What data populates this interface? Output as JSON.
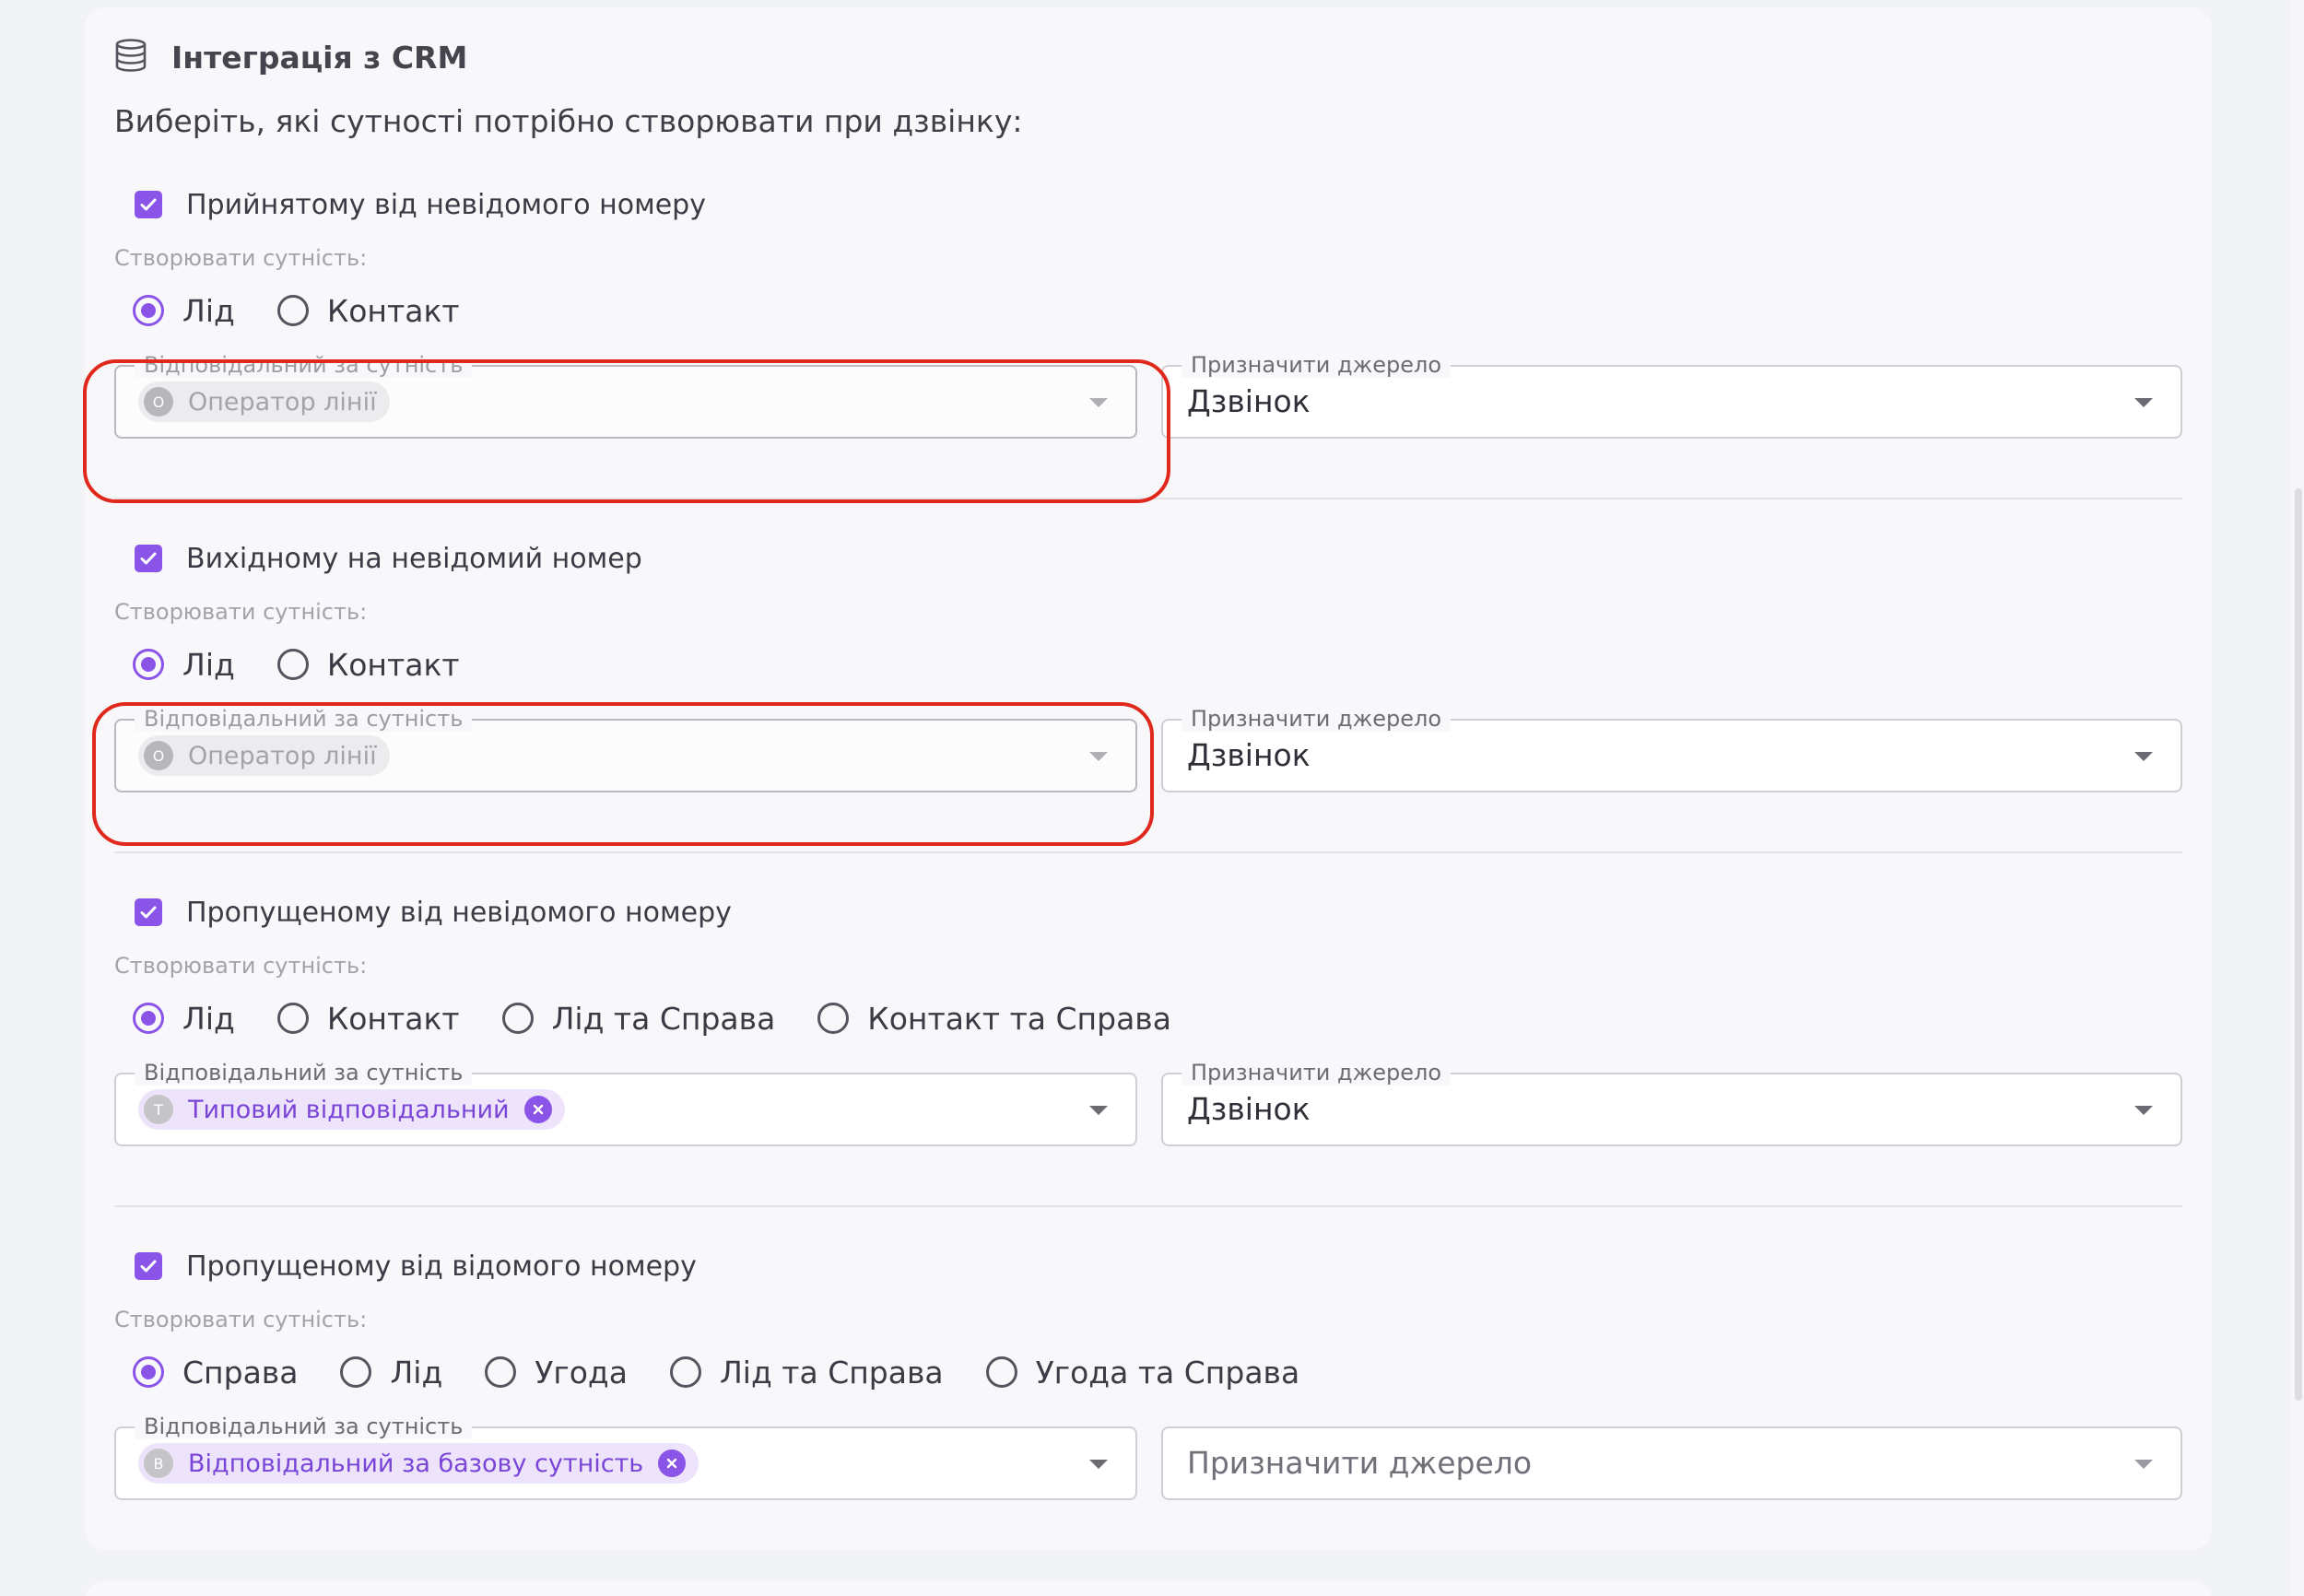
{
  "header": {
    "title": "Інтеграція з CRM",
    "icon": "database-stack-icon"
  },
  "subtitle": "Виберіть, які сутності потрібно створювати при дзвінку:",
  "accent_color": "#8b54e8",
  "highlight_color": "#e0291c",
  "sections": [
    {
      "checkbox_label": "Прийнятому від невідомого номеру",
      "checked": true,
      "create_label": "Створювати сутність:",
      "radios": [
        "Лід",
        "Контакт"
      ],
      "selected_radio": "Лід",
      "responsible": {
        "legend": "Відповідальний за сутність",
        "chip_initial": "О",
        "chip_text": "Оператор лінії",
        "disabled": true
      },
      "source": {
        "legend": "Призначити джерело",
        "value": "Дзвінок"
      }
    },
    {
      "checkbox_label": "Вихідному на невідомий номер",
      "checked": true,
      "create_label": "Створювати сутність:",
      "radios": [
        "Лід",
        "Контакт"
      ],
      "selected_radio": "Лід",
      "responsible": {
        "legend": "Відповідальний за сутність",
        "chip_initial": "О",
        "chip_text": "Оператор лінії",
        "disabled": true
      },
      "source": {
        "legend": "Призначити джерело",
        "value": "Дзвінок"
      }
    },
    {
      "checkbox_label": "Пропущеному від невідомого номеру",
      "checked": true,
      "create_label": "Створювати сутність:",
      "radios": [
        "Лід",
        "Контакт",
        "Лід та Справа",
        "Контакт та Справа"
      ],
      "selected_radio": "Лід",
      "responsible": {
        "legend": "Відповідальний за сутність",
        "chip_initial": "Т",
        "chip_text": "Типовий відповідальний",
        "disabled": false
      },
      "source": {
        "legend": "Призначити джерело",
        "value": "Дзвінок"
      }
    },
    {
      "checkbox_label": "Пропущеному від відомого номеру",
      "checked": true,
      "create_label": "Створювати сутність:",
      "radios": [
        "Справа",
        "Лід",
        "Угода",
        "Лід та Справа",
        "Угода та Справа"
      ],
      "selected_radio": "Справа",
      "responsible": {
        "legend": "Відповідальний за сутність",
        "chip_initial": "В",
        "chip_text": "Відповідальний за базову сутність",
        "disabled": false
      },
      "source": {
        "placeholder": "Призначити джерело"
      }
    }
  ]
}
